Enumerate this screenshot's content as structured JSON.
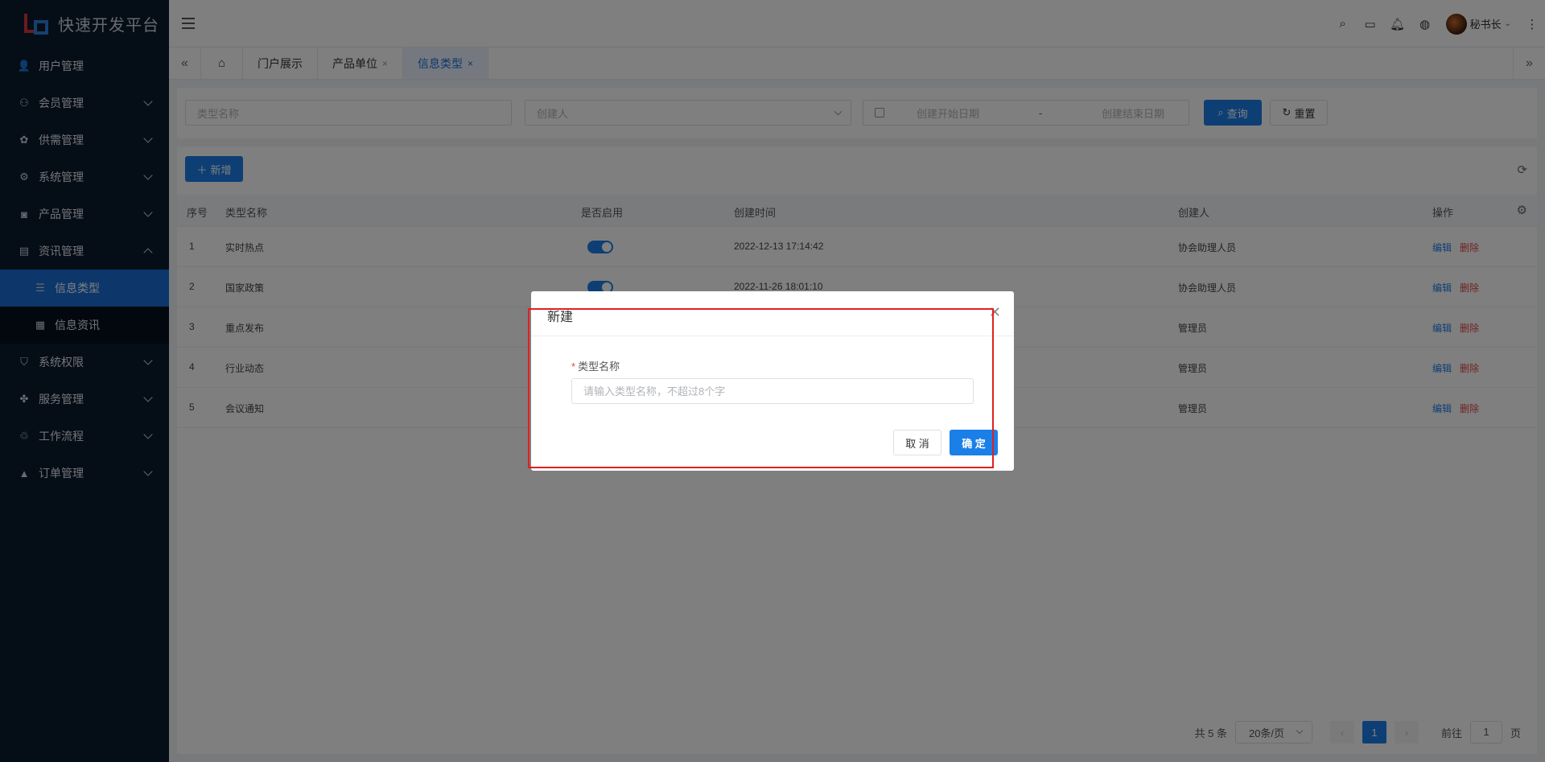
{
  "app": {
    "title": "快速开发平台"
  },
  "sidebar": {
    "items": [
      {
        "label": "用户管理",
        "icon": "user-icon",
        "glyph": "👤",
        "chevron": ""
      },
      {
        "label": "会员管理",
        "icon": "members-icon",
        "glyph": "⚇",
        "chevron": "down"
      },
      {
        "label": "供需管理",
        "icon": "grid-icon",
        "glyph": "✿",
        "chevron": "down"
      },
      {
        "label": "系统管理",
        "icon": "gear-icon",
        "glyph": "⚙",
        "chevron": "down"
      },
      {
        "label": "产品管理",
        "icon": "product-icon",
        "glyph": "◙",
        "chevron": "down"
      },
      {
        "label": "资讯管理",
        "icon": "news-icon",
        "glyph": "▤",
        "chevron": "up"
      }
    ],
    "submenu": [
      {
        "label": "信息类型",
        "icon": "list-icon",
        "glyph": "☰",
        "active": true
      },
      {
        "label": "信息资讯",
        "icon": "document-icon",
        "glyph": "▦",
        "active": false
      }
    ],
    "items_after": [
      {
        "label": "系统权限",
        "icon": "shield-icon",
        "glyph": "⛉",
        "chevron": "down"
      },
      {
        "label": "服务管理",
        "icon": "service-icon",
        "glyph": "✤",
        "chevron": "down"
      },
      {
        "label": "工作流程",
        "icon": "workflow-icon",
        "glyph": "♲",
        "chevron": "down"
      },
      {
        "label": "订单管理",
        "icon": "order-icon",
        "glyph": "▲",
        "chevron": "down"
      }
    ]
  },
  "header": {
    "user_name": "秘书长"
  },
  "tabs": [
    {
      "label": "门户展示",
      "closable": false,
      "active": false
    },
    {
      "label": "产品单位",
      "closable": true,
      "active": false
    },
    {
      "label": "信息类型",
      "closable": true,
      "active": true
    }
  ],
  "search": {
    "type_name_placeholder": "类型名称",
    "creator_placeholder": "创建人",
    "start_date_placeholder": "创建开始日期",
    "date_separator": "-",
    "end_date_placeholder": "创建结束日期",
    "query_label": "查询",
    "reset_label": "重置"
  },
  "toolbar": {
    "add_label": "新增"
  },
  "table": {
    "headers": [
      "序号",
      "类型名称",
      "是否启用",
      "创建时间",
      "创建人",
      "操作"
    ],
    "rows": [
      {
        "no": "1",
        "name": "实时热点",
        "enabled": true,
        "created": "2022-12-13 17:14:42",
        "creator": "协会助理人员"
      },
      {
        "no": "2",
        "name": "国家政策",
        "enabled": true,
        "created": "2022-11-26 18:01:10",
        "creator": "协会助理人员"
      },
      {
        "no": "3",
        "name": "重点发布",
        "enabled": true,
        "created": "",
        "creator": "管理员"
      },
      {
        "no": "4",
        "name": "行业动态",
        "enabled": true,
        "created": "",
        "creator": "管理员"
      },
      {
        "no": "5",
        "name": "会议通知",
        "enabled": true,
        "created": "",
        "creator": "管理员"
      }
    ],
    "edit_label": "编辑",
    "delete_label": "删除"
  },
  "pagination": {
    "total_text": "共 5 条",
    "page_size": "20条/页",
    "current_page": "1",
    "goto_label": "前往",
    "goto_value": "1",
    "page_suffix": "页"
  },
  "dialog": {
    "title": "新建",
    "field_label": "类型名称",
    "required_mark": "*",
    "field_placeholder": "请输入类型名称，不超过8个字",
    "cancel_label": "取 消",
    "ok_label": "确 定"
  },
  "colors": {
    "primary": "#1b7fe8",
    "sidebar_bg": "#0a1a2f",
    "danger": "#e04444",
    "highlight": "#e02020"
  }
}
